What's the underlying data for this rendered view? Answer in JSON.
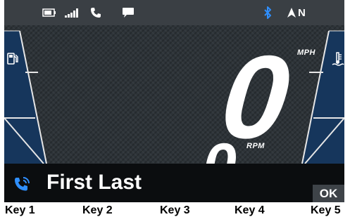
{
  "status_bar": {
    "icons": [
      "battery-icon",
      "signal-bars-icon",
      "phone-icon",
      "message-icon",
      "bluetooth-icon",
      "compass-arrow-icon"
    ],
    "heading": "N"
  },
  "speed": {
    "value": "0",
    "unit": "MPH"
  },
  "rpm": {
    "value": "0",
    "unit": "RPM"
  },
  "gauges": {
    "left_icon": "fuel-pump-icon",
    "right_icon": "coolant-temp-icon"
  },
  "notification": {
    "icon": "phone-call-icon",
    "caller": "First Last",
    "ok_label": "OK"
  },
  "keys": [
    "Key 1",
    "Key 2",
    "Key 3",
    "Key 4",
    "Key 5"
  ],
  "colors": {
    "accent_blue": "#2f8fff",
    "gauge_fill": "#16365c",
    "screen_bg": "#2d3338"
  }
}
